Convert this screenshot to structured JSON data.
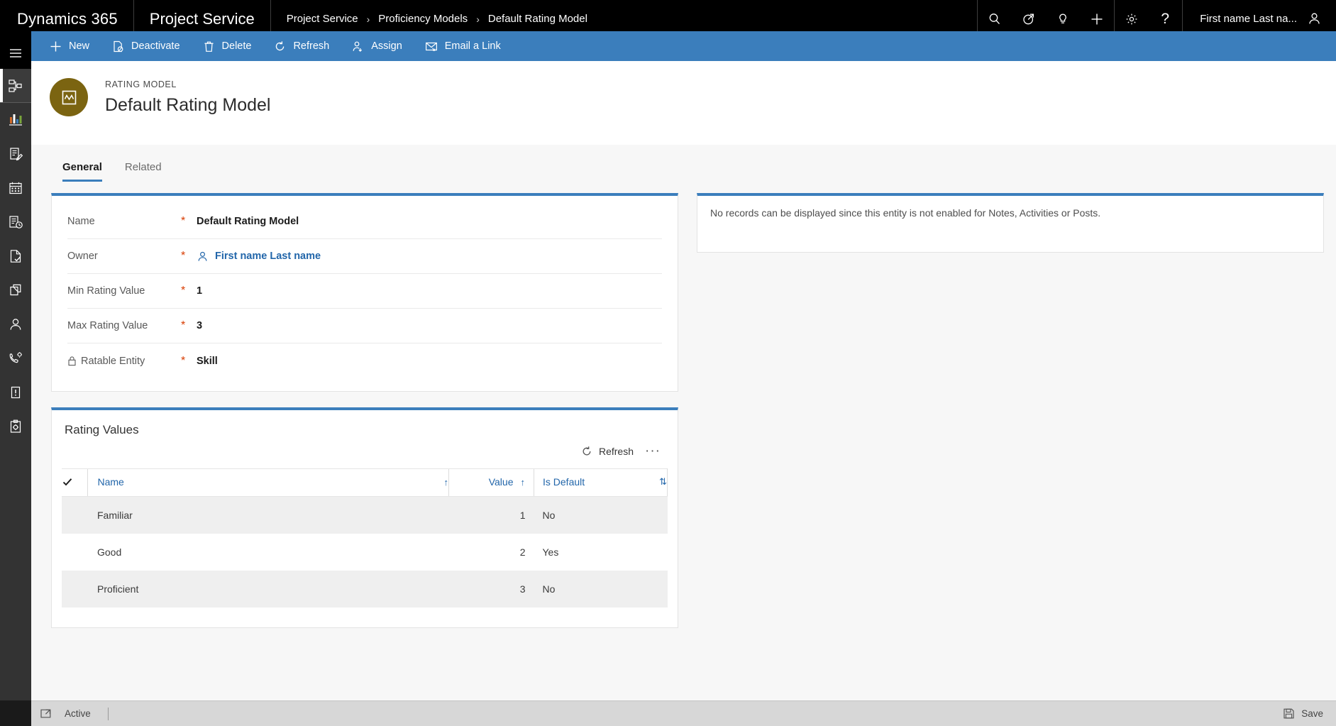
{
  "topnav": {
    "brand": "Dynamics 365",
    "app": "Project Service",
    "breadcrumb": [
      "Project Service",
      "Proficiency Models",
      "Default Rating Model"
    ],
    "separator": "›",
    "icons": [
      "search-icon",
      "assistant-icon",
      "lightbulb-icon",
      "plus-icon",
      "gear-icon",
      "help-icon"
    ],
    "user_name": "First name Last na..."
  },
  "rail": {
    "burger": "hamburger-menu-icon",
    "items": [
      {
        "icon": "sitemap-icon",
        "selected": true
      },
      {
        "icon": "dashboard-chart-icon",
        "selected": false
      },
      {
        "icon": "edit-document-icon",
        "selected": false
      },
      {
        "icon": "calendar-icon",
        "selected": false
      },
      {
        "icon": "time-entry-icon",
        "selected": false
      },
      {
        "icon": "approval-document-icon",
        "selected": false
      },
      {
        "icon": "expense-icon",
        "selected": false
      },
      {
        "icon": "contact-person-icon",
        "selected": false
      },
      {
        "icon": "service-call-icon",
        "selected": false
      },
      {
        "icon": "alert-note-icon",
        "selected": false
      },
      {
        "icon": "clipboard-settings-icon",
        "selected": false
      }
    ]
  },
  "commandbar": {
    "buttons": [
      {
        "label": "New",
        "icon": "plus-icon"
      },
      {
        "label": "Deactivate",
        "icon": "deactivate-icon"
      },
      {
        "label": "Delete",
        "icon": "trash-icon"
      },
      {
        "label": "Refresh",
        "icon": "refresh-icon"
      },
      {
        "label": "Assign",
        "icon": "assign-person-icon"
      },
      {
        "label": "Email a Link",
        "icon": "email-link-icon"
      }
    ]
  },
  "record": {
    "entity_label": "RATING MODEL",
    "title": "Default Rating Model",
    "avatar_color": "#7b6411",
    "avatar_icon": "rating-model-icon"
  },
  "tabs": [
    {
      "label": "General",
      "active": true
    },
    {
      "label": "Related",
      "active": false
    }
  ],
  "form": {
    "fields": [
      {
        "label": "Name",
        "required": "*",
        "value": "Default Rating Model",
        "type": "text",
        "locked": false
      },
      {
        "label": "Owner",
        "required": "*",
        "value": "First name Last name",
        "type": "lookup",
        "locked": false
      },
      {
        "label": "Min Rating Value",
        "required": "*",
        "value": "1",
        "type": "text",
        "locked": false
      },
      {
        "label": "Max Rating Value",
        "required": "*",
        "value": "3",
        "type": "text",
        "locked": false
      },
      {
        "label": "Ratable Entity",
        "required": "*",
        "value": "Skill",
        "type": "text",
        "locked": true
      }
    ]
  },
  "subgrid": {
    "title": "Rating Values",
    "refresh_label": "Refresh",
    "more_label": "···",
    "columns": [
      {
        "label": "Name",
        "sort": "↑"
      },
      {
        "label": "Value",
        "sort": "↑"
      },
      {
        "label": "Is Default",
        "sort": "⇅"
      }
    ],
    "rows": [
      {
        "name": "Familiar",
        "value": "1",
        "is_default": "No"
      },
      {
        "name": "Good",
        "value": "2",
        "is_default": "Yes"
      },
      {
        "name": "Proficient",
        "value": "3",
        "is_default": "No"
      }
    ]
  },
  "notes": {
    "message": "No records can be displayed since this entity is not enabled for Notes, Activities or Posts."
  },
  "statusbar": {
    "state": "Active",
    "state_icon": "popout-icon",
    "save_label": "Save",
    "save_icon": "save-disk-icon"
  },
  "colors": {
    "topnav_bg": "#000000",
    "command_bar": "#3b7ebc",
    "accent": "#3b7ebc",
    "link": "#2266aa",
    "required": "#d83b01",
    "rail_bg": "#333333",
    "body_bg": "#f7f7f7",
    "status_bg": "#d7d7d7"
  }
}
